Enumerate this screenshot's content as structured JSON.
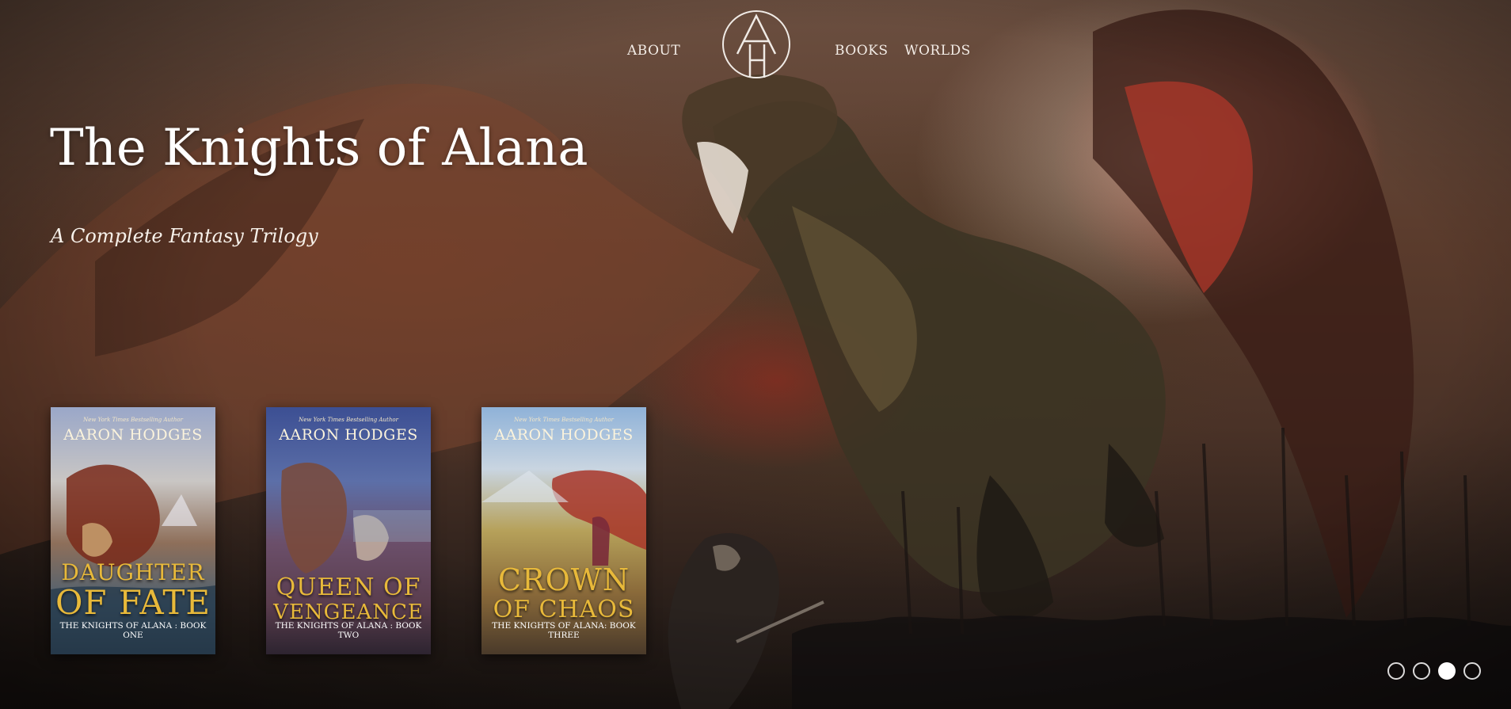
{
  "nav": {
    "about": "ABOUT",
    "books": "BOOKS",
    "worlds": "WORLDS",
    "logo_letters": "AH"
  },
  "hero": {
    "title": "The Knights of Alana",
    "subtitle": "A Complete Fantasy Trilogy"
  },
  "books": [
    {
      "tagline": "New York Times Bestselling Author",
      "author": "AARON HODGES",
      "title_line1": "DAUGHTER",
      "title_line2": "OF FATE",
      "series": "THE KNIGHTS OF ALANA : BOOK ONE"
    },
    {
      "tagline": "New York Times Bestselling Author",
      "author": "AARON HODGES",
      "title_line1": "QUEEN OF",
      "title_line2": "VENGEANCE",
      "series": "THE KNIGHTS OF ALANA : BOOK TWO"
    },
    {
      "tagline": "New York Times Bestselling Author",
      "author": "AARON HODGES",
      "title_line1": "CROWN",
      "title_line2": "OF CHAOS",
      "series": "THE KNIGHTS OF ALANA: BOOK THREE"
    }
  ],
  "carousel": {
    "slide_count": 4,
    "active_index": 2
  },
  "colors": {
    "accent_gold": "#e8b93a",
    "text": "#ffffff"
  }
}
